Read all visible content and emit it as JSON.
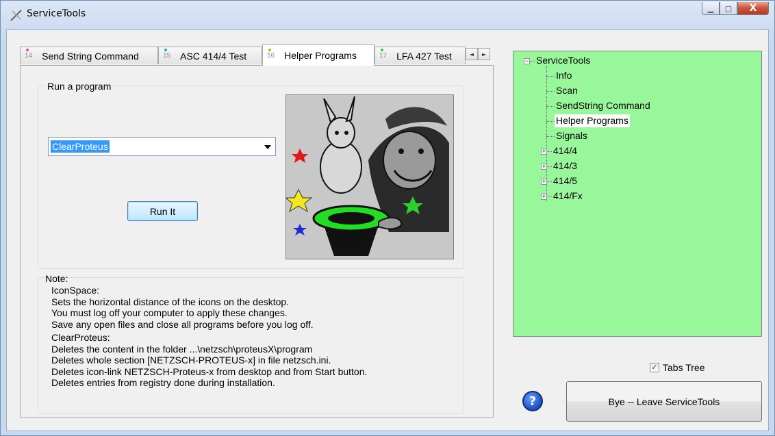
{
  "window": {
    "title": "ServiceTools",
    "minimize_glyph": "▁",
    "maximize_glyph": "▢",
    "close_glyph": "X"
  },
  "tabs": [
    {
      "number": "14",
      "label": "Send String Command",
      "dot_color": "#e040c0"
    },
    {
      "number": "15",
      "label": "ASC 414/4 Test",
      "dot_color": "#20a0d0"
    },
    {
      "number": "16",
      "label": "Helper Programs",
      "dot_color": "#e0a020",
      "active": true
    },
    {
      "number": "17",
      "label": "LFA 427 Test",
      "dot_color": "#40c040"
    }
  ],
  "tab_scroll": {
    "left": "◄",
    "right": "►"
  },
  "run_group": {
    "label": "Run a program"
  },
  "program_select": {
    "value": "ClearProteus"
  },
  "run_button": {
    "label": "Run It"
  },
  "note": {
    "label": "Note:",
    "icon_space": [
      "IconSpace:",
      "Sets the horizontal distance of the icons on the desktop.",
      "You must log off your computer to apply these changes.",
      "Save any open files and close all programs before you log off."
    ],
    "clear_proteus": [
      "ClearProteus:",
      "Deletes the content in the folder ...\\netzsch\\proteusX\\program",
      "Deletes whole section [NETZSCH-PROTEUS-x] in file netzsch.ini.",
      "Deletes icon-link NETZSCH-Proteus-x from desktop and from Start button.",
      "Deletes entries from registry done during installation."
    ]
  },
  "tree": {
    "root": "ServiceTools",
    "root_expander": "−",
    "leaf_items": [
      "Info",
      "Scan",
      "SendString Command",
      "Helper Programs",
      "Signals"
    ],
    "selected": "Helper Programs",
    "collapsed_items": [
      "414/4",
      "414/3",
      "414/5",
      "414/Fx"
    ],
    "collapsed_expander": "+",
    "background_color": "#99f79b"
  },
  "tabs_tree_checkbox": {
    "label": "Tabs Tree",
    "checked": true,
    "check_glyph": "✓"
  },
  "help_button": {
    "icon": "help-icon",
    "glyph": "?"
  },
  "bye_button": {
    "label": "Bye  --  Leave ServiceTools"
  }
}
